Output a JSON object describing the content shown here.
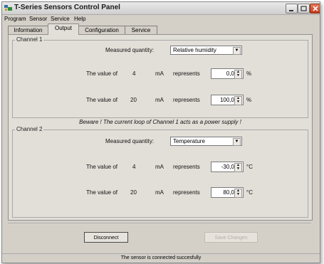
{
  "window": {
    "title": "T-Series Sensors Control Panel"
  },
  "menu": [
    "Program",
    "Sensor",
    "Service",
    "Help"
  ],
  "tabs": [
    "Information",
    "Output",
    "Configuration",
    "Service"
  ],
  "channel1": {
    "title": "Channel 1",
    "measured_quantity_label": "Measured quantity:",
    "measured_quantity_value": "Relative humidity",
    "rows": [
      {
        "prefix": "The value of",
        "ma": "4",
        "unit_ma": "mA",
        "represents": "represents",
        "value": "0,0",
        "unit": "%"
      },
      {
        "prefix": "The value of",
        "ma": "20",
        "unit_ma": "mA",
        "represents": "represents",
        "value": "100,0",
        "unit": "%"
      }
    ]
  },
  "warning": "Beware ! The current loop of Channel 1 acts as a power supply !",
  "channel2": {
    "title": "Channel 2",
    "measured_quantity_label": "Measured quantity:",
    "measured_quantity_value": "Temperature",
    "rows": [
      {
        "prefix": "The value of",
        "ma": "4",
        "unit_ma": "mA",
        "represents": "represents",
        "value": "-30,0",
        "unit": "°C"
      },
      {
        "prefix": "The value of",
        "ma": "20",
        "unit_ma": "mA",
        "represents": "represents",
        "value": "80,0",
        "unit": "°C"
      }
    ]
  },
  "buttons": {
    "disconnect": "Disconnect",
    "save_changes": "Save Changes"
  },
  "status": "The sensor is connected succesfully"
}
